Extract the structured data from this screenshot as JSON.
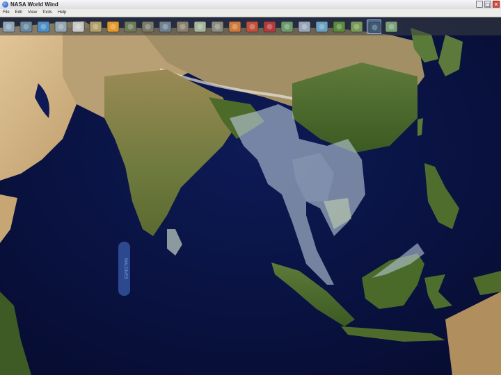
{
  "app": {
    "title": "NASA World Wind",
    "window_buttons": {
      "minimize": "_",
      "maximize": "□",
      "close": "✕"
    }
  },
  "menu": [
    "File",
    "Edit",
    "View",
    "Tools",
    "Help"
  ],
  "toolbar": {
    "tools": [
      {
        "name": "layer-manager-icon",
        "color": "#8fa7b8",
        "active": false
      },
      {
        "name": "world-view-icon",
        "color": "#6a8aa0",
        "active": false
      },
      {
        "name": "globe-icon",
        "color": "#4d8fc7",
        "active": false
      },
      {
        "name": "search-icon",
        "color": "#93a7b2",
        "active": false
      },
      {
        "name": "moon-icon",
        "color": "#c9c9c9",
        "active": false
      },
      {
        "name": "landsat-icon",
        "color": "#b2a06a",
        "active": false
      },
      {
        "name": "heat-map-icon",
        "color": "#e39a2a",
        "active": false
      },
      {
        "name": "satellite-image-1-icon",
        "color": "#6f7a5a",
        "active": false
      },
      {
        "name": "satellite-image-2-icon",
        "color": "#7a7a6a",
        "active": false
      },
      {
        "name": "satellite-image-3-icon",
        "color": "#708090",
        "active": false
      },
      {
        "name": "satellite-image-4-icon",
        "color": "#8a8070",
        "active": false
      },
      {
        "name": "topo-map-icon",
        "color": "#a6b59a",
        "active": false
      },
      {
        "name": "usgs-map-icon",
        "color": "#8c8c80",
        "active": false
      },
      {
        "name": "weather-icon",
        "color": "#cf7a3a",
        "active": false
      },
      {
        "name": "flag-1-icon",
        "color": "#c2513b",
        "active": false
      },
      {
        "name": "flag-2-icon",
        "color": "#b53a3a",
        "active": false
      },
      {
        "name": "compass-icon",
        "color": "#6c9a6c",
        "active": false
      },
      {
        "name": "usa-map-icon",
        "color": "#9aa6b8",
        "active": false
      },
      {
        "name": "placename-icon",
        "color": "#6aa0c0",
        "active": false
      },
      {
        "name": "forest-icon",
        "color": "#5a8a3a",
        "active": false
      },
      {
        "name": "terrain-icon",
        "color": "#7a9a5a",
        "active": false
      },
      {
        "name": "boundaries-icon",
        "color": "#3e5a74",
        "active": true
      },
      {
        "name": "mosaic-icon",
        "color": "#7aa07a",
        "active": false
      }
    ]
  },
  "globe": {
    "colors": {
      "ocean": "#0b1446",
      "land_desert": "#c9ab7a",
      "land_green": "#4f6b2c",
      "highlight": "#b8c8d8"
    },
    "label_vertical": "MALDIVES"
  }
}
